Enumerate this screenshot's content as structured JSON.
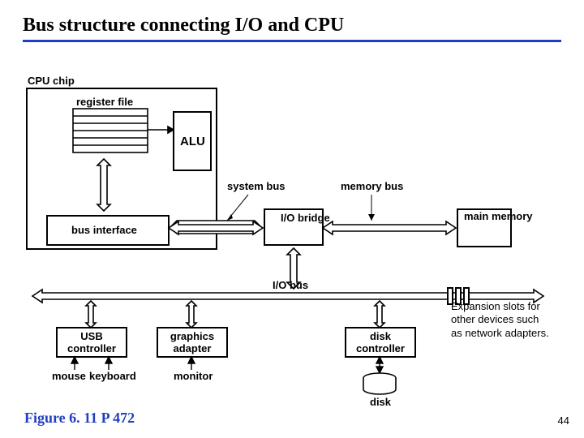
{
  "title": "Bus structure connecting I/O and CPU",
  "labels": {
    "cpu_chip": "CPU chip",
    "register_file": "register file",
    "alu": "ALU",
    "system_bus": "system bus",
    "memory_bus": "memory bus",
    "bus_interface": "bus interface",
    "io_bridge": "I/O bridge",
    "main_memory": "main memory",
    "io_bus": "I/O bus",
    "usb_controller_l1": "USB",
    "usb_controller_l2": "controller",
    "graphics_adapter_l1": "graphics",
    "graphics_adapter_l2": "adapter",
    "disk_controller_l1": "disk",
    "disk_controller_l2": "controller",
    "mouse": "mouse",
    "keyboard": "keyboard",
    "monitor": "monitor",
    "disk": "disk",
    "expansion_l1": "Expansion slots for",
    "expansion_l2": "other devices such",
    "expansion_l3": "as network adapters."
  },
  "figure_ref": "Figure 6. 11  P 472",
  "page_number": "44"
}
